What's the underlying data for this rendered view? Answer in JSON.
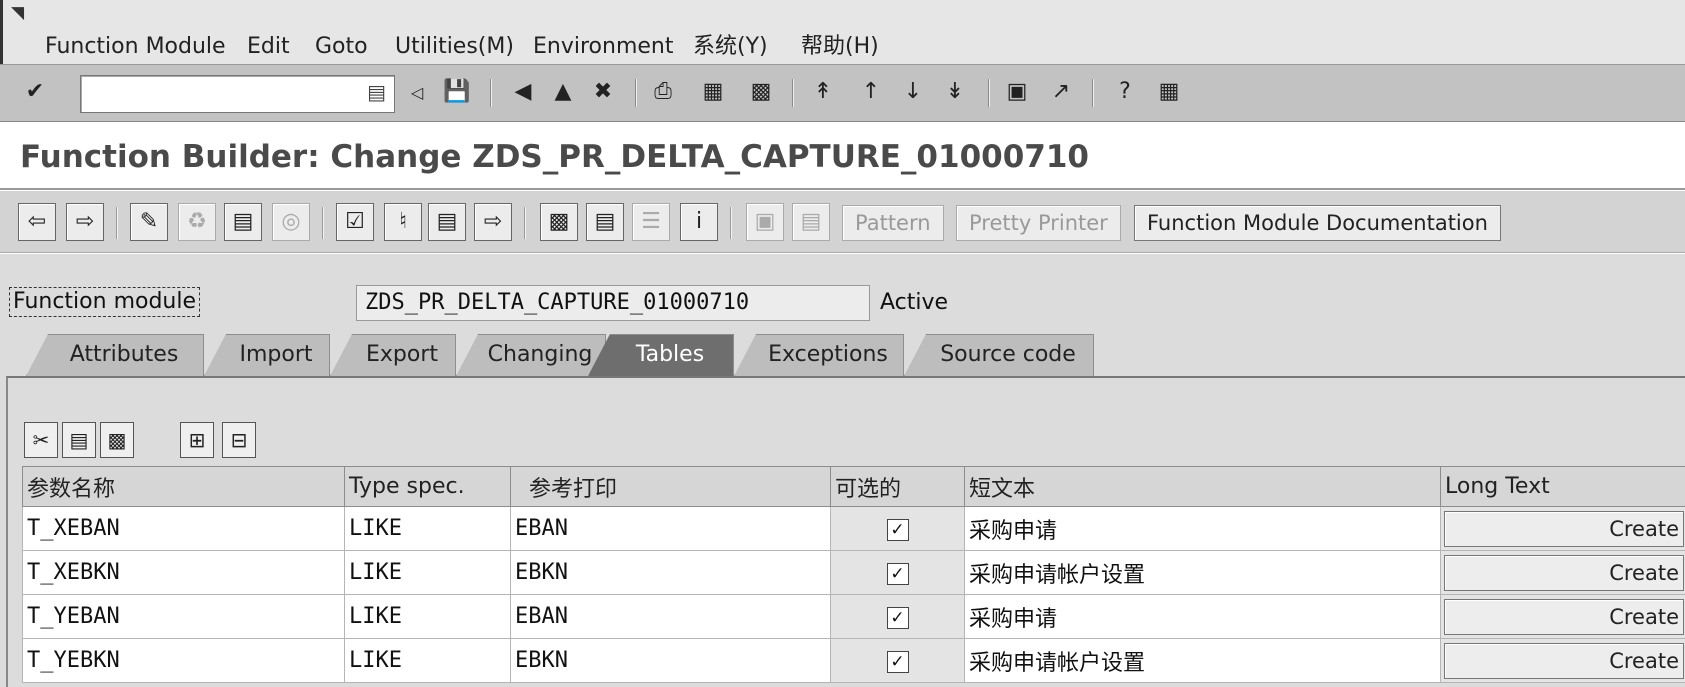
{
  "menubar": {
    "items": [
      {
        "label": "Function Module"
      },
      {
        "label": "Edit"
      },
      {
        "label": "Goto"
      },
      {
        "label": "Utilities(M)"
      },
      {
        "label": "Environment"
      },
      {
        "label": "系统(Y)"
      },
      {
        "label": "帮助(H)"
      }
    ]
  },
  "title": "Function Builder: Change ZDS_PR_DELTA_CAPTURE_01000710",
  "appbar": {
    "pattern_label": "Pattern",
    "pretty_printer_label": "Pretty Printer",
    "documentation_label": "Function Module Documentation"
  },
  "header": {
    "fm_label": "Function module",
    "fm_value": "ZDS_PR_DELTA_CAPTURE_01000710",
    "fm_status": "Active"
  },
  "tabs": [
    {
      "label": "Attributes"
    },
    {
      "label": "Import"
    },
    {
      "label": "Export"
    },
    {
      "label": "Changing"
    },
    {
      "label": "Tables",
      "active": true
    },
    {
      "label": "Exceptions"
    },
    {
      "label": "Source code"
    }
  ],
  "table": {
    "columns": [
      "参数名称",
      "Type spec.",
      "参考打印",
      "可选的",
      "短文本",
      "Long Text"
    ],
    "rows": [
      {
        "param": "T_XEBAN",
        "type": "LIKE",
        "ref": "EBAN",
        "optional": true,
        "text": "采购申请",
        "action": "Create"
      },
      {
        "param": "T_XEBKN",
        "type": "LIKE",
        "ref": "EBKN",
        "optional": true,
        "text": "采购申请帐户设置",
        "action": "Create"
      },
      {
        "param": "T_YEBAN",
        "type": "LIKE",
        "ref": "EBAN",
        "optional": true,
        "text": "采购申请",
        "action": "Create"
      },
      {
        "param": "T_YEBKN",
        "type": "LIKE",
        "ref": "EBKN",
        "optional": true,
        "text": "采购申请帐户设置",
        "action": "Create"
      }
    ]
  },
  "icons": {
    "enter": "check-icon",
    "save": "save-icon",
    "back": "back-icon",
    "exit": "exit-icon",
    "cancel": "cancel-icon",
    "help": "help-icon"
  },
  "colors": {
    "active_tab": "#6e6e6e",
    "toolbar": "#c2c2c2",
    "panel": "#dcdcdc"
  }
}
